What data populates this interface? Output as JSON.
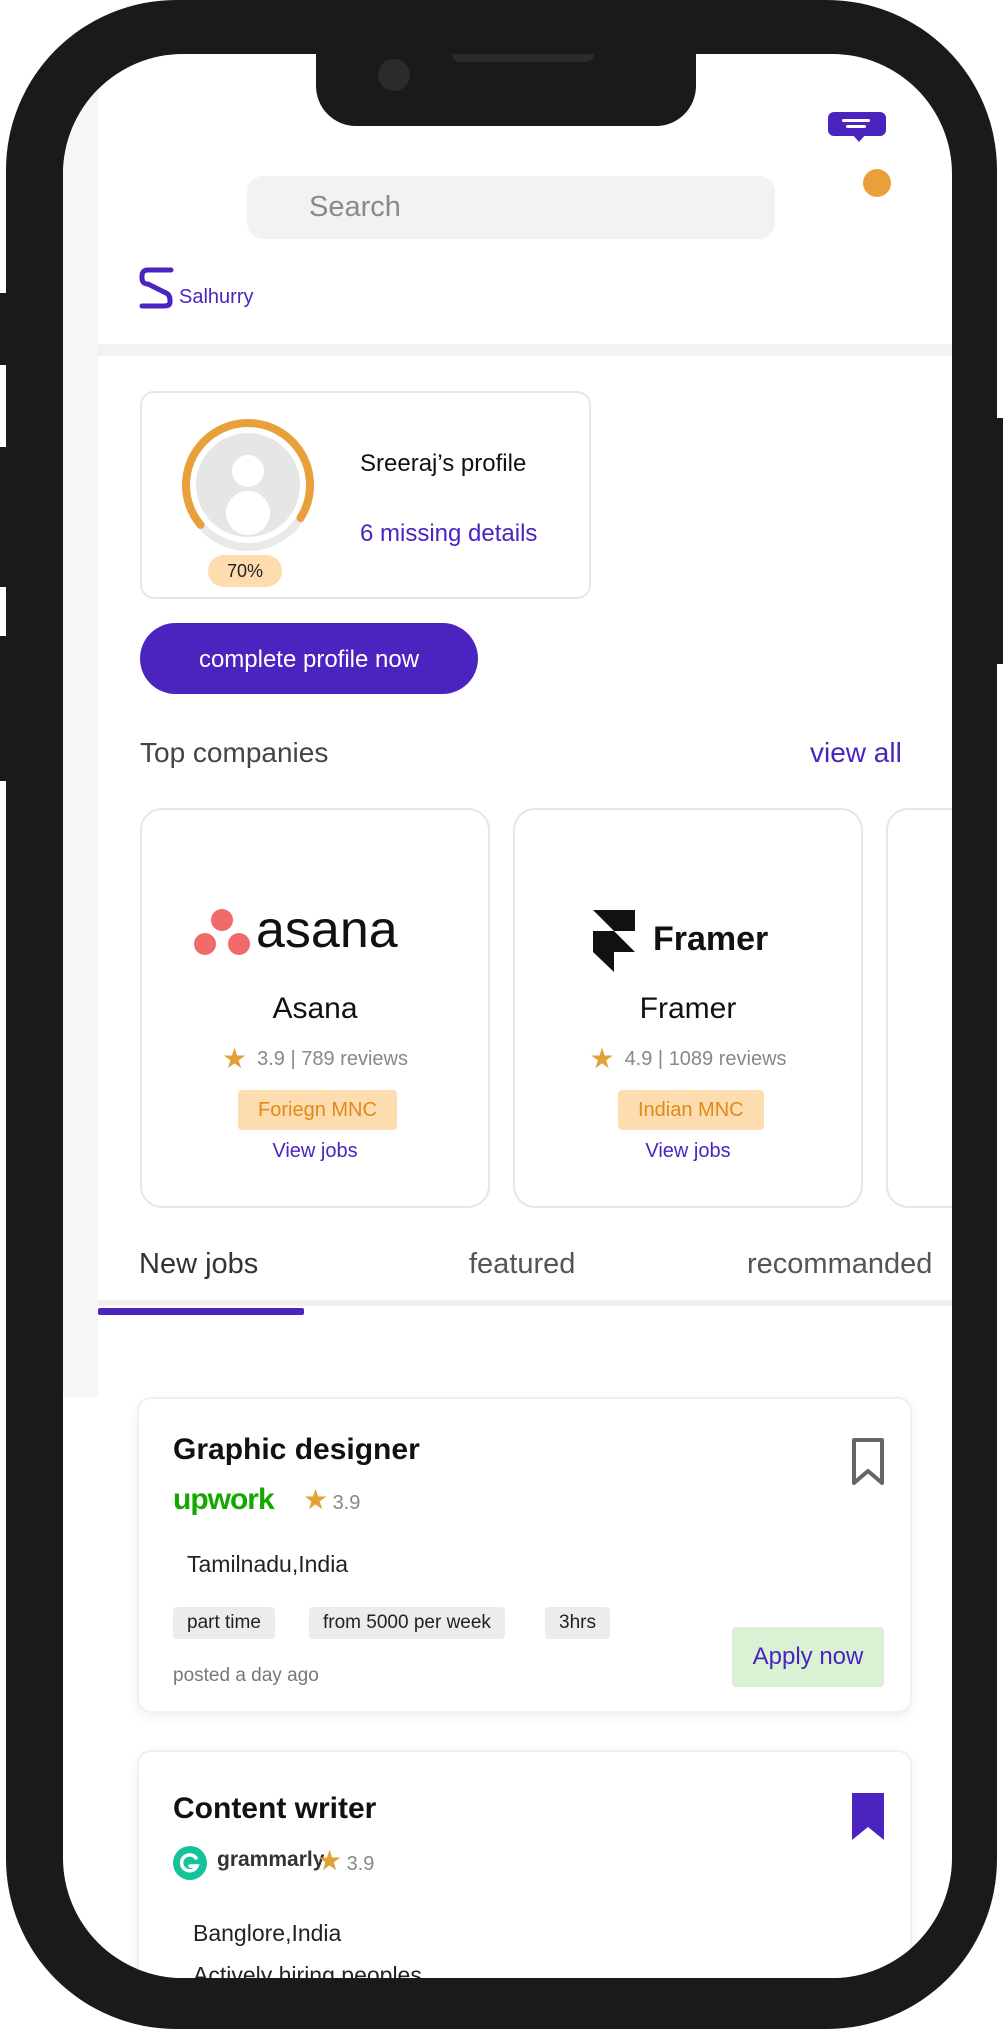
{
  "search": {
    "placeholder": "Search"
  },
  "brand": {
    "name": "Salhurry"
  },
  "profile": {
    "name": "Sreeraj’s profile",
    "missing": "6 missing details",
    "completion_label": "70%",
    "completion": 0.7,
    "cta": "complete profile now"
  },
  "top_companies": {
    "title": "Top companies",
    "view_all": "view all",
    "items": [
      {
        "logo_text": "asana",
        "name": "Asana",
        "rating": "3.9",
        "reviews": "789 reviews",
        "tag": "Foriegn MNC",
        "view_jobs": "View jobs"
      },
      {
        "logo_text": "Framer",
        "name": "Framer",
        "rating": "4.9",
        "reviews": "1089 reviews",
        "tag": "Indian MNC",
        "view_jobs": "View jobs"
      }
    ]
  },
  "tabs": [
    {
      "label": "New jobs",
      "active": true
    },
    {
      "label": "featured",
      "active": false
    },
    {
      "label": "recommanded",
      "active": false
    }
  ],
  "jobs": [
    {
      "title": "Graphic designer",
      "company_logo": "upwork",
      "rating": "3.9",
      "location": "Tamilnadu,India",
      "chips": [
        "part time",
        "from 5000 per week",
        "3hrs"
      ],
      "posted": "posted a day ago",
      "apply": "Apply now",
      "bookmarked": false
    },
    {
      "title": "Content writer",
      "company_logo": "grammarly",
      "rating": "3.9",
      "location": "Banglore,India",
      "note": "Actively hiring peoples",
      "bookmarked": true
    }
  ],
  "colors": {
    "primary": "#4b24c0",
    "accent": "#eaa03a",
    "tag_bg": "#fddcaf",
    "apply_bg": "#d9f2d4"
  }
}
